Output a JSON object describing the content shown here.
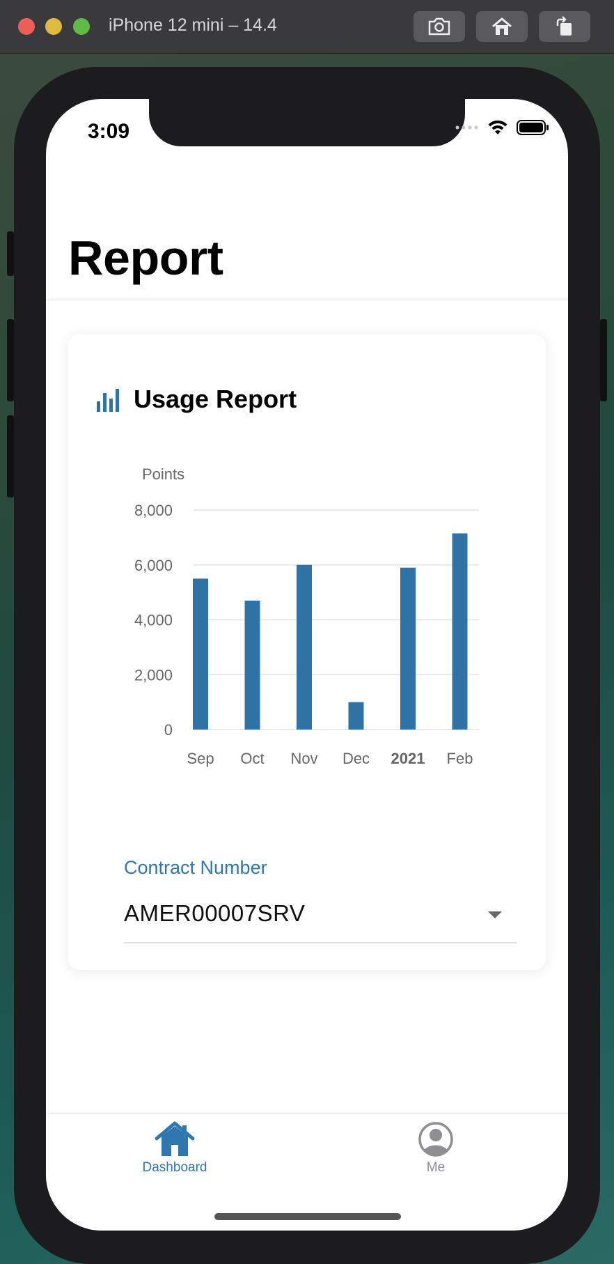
{
  "simulator": {
    "title": "iPhone 12 mini – 14.4",
    "buttons": [
      "screenshot-icon",
      "home-icon",
      "rotate-icon"
    ]
  },
  "status_bar": {
    "time": "3:09"
  },
  "page": {
    "title": "Report"
  },
  "card": {
    "icon": "bar-chart-icon",
    "title": "Usage Report"
  },
  "chart_data": {
    "type": "bar",
    "ylabel": "Points",
    "xlabel": "",
    "categories": [
      "Sep",
      "Oct",
      "Nov",
      "Dec",
      "2021",
      "Feb"
    ],
    "values": [
      5500,
      4700,
      6000,
      1000,
      5900,
      7150
    ],
    "ylim": [
      0,
      8000
    ],
    "yticks": [
      "0",
      "2,000",
      "4,000",
      "6,000",
      "8,000"
    ],
    "bold_categories": [
      "2021"
    ],
    "grid": true,
    "color": "#2f73a6"
  },
  "contract": {
    "label": "Contract Number",
    "value": "AMER00007SRV"
  },
  "tabbar": {
    "items": [
      {
        "label": "Dashboard",
        "icon": "house-icon",
        "active": true
      },
      {
        "label": "Me",
        "icon": "user-circle-icon",
        "active": false
      }
    ]
  },
  "colors": {
    "accent": "#2f77ae",
    "bar": "#2f73a6",
    "inactive": "#8e8e93"
  }
}
